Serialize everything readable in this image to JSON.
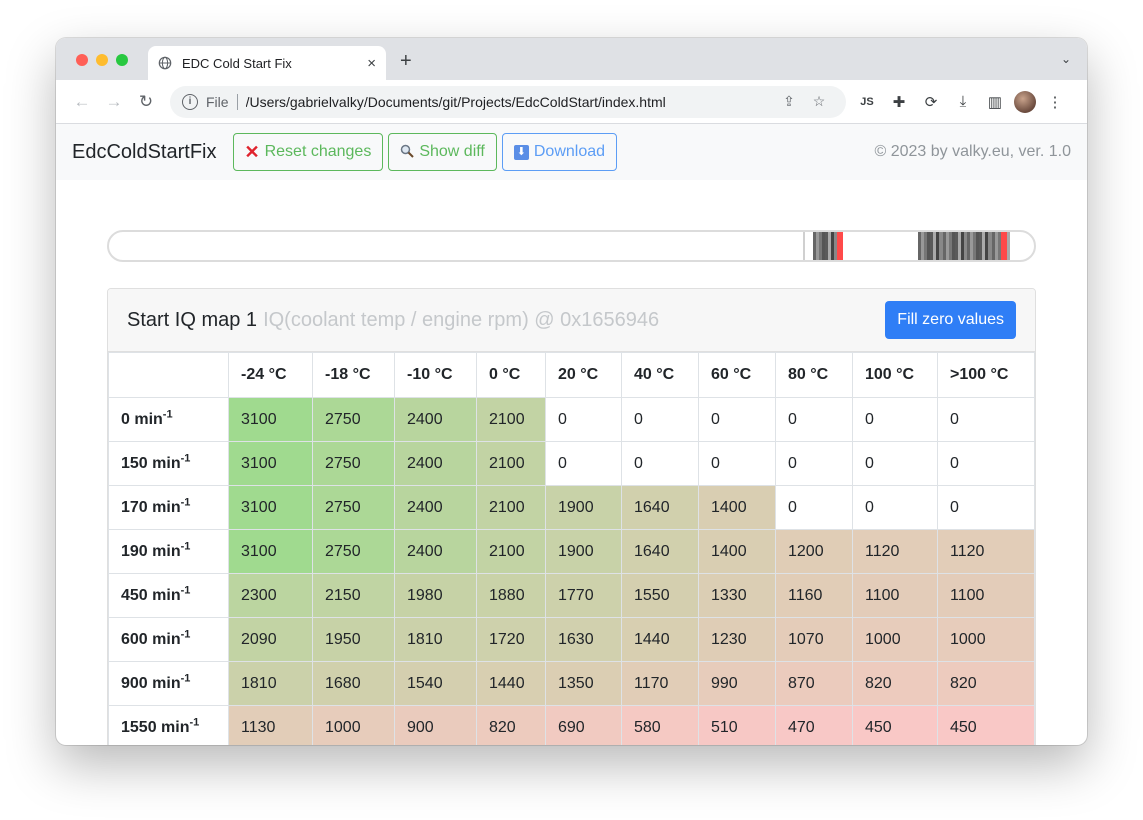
{
  "browser": {
    "tab_title": "EDC Cold Start Fix",
    "tab_close": "×",
    "new_tab": "+",
    "address_scheme": "File",
    "address_url": "/Users/gabrielvalky/Documents/git/Projects/EdcColdStart/index.html"
  },
  "app": {
    "brand": "EdcColdStartFix",
    "reset_label": "Reset changes",
    "diff_label": "Show diff",
    "download_label": "Download",
    "copyright": "© 2023 by valky.eu, ver. 1.0"
  },
  "map": {
    "title": "Start IQ map 1",
    "subtitle": "IQ(coolant temp / engine rpm) @ 0x1656946",
    "fill_button": "Fill zero values",
    "columns": [
      "-24 °C",
      "-18 °C",
      "-10 °C",
      "0 °C",
      "20 °C",
      "40 °C",
      "60 °C",
      "80 °C",
      "100 °C",
      ">100 °C"
    ],
    "rows": [
      {
        "rpm": "0 min",
        "exp": "-1",
        "values": [
          3100,
          2750,
          2400,
          2100,
          0,
          0,
          0,
          0,
          0,
          0
        ]
      },
      {
        "rpm": "150 min",
        "exp": "-1",
        "values": [
          3100,
          2750,
          2400,
          2100,
          0,
          0,
          0,
          0,
          0,
          0
        ]
      },
      {
        "rpm": "170 min",
        "exp": "-1",
        "values": [
          3100,
          2750,
          2400,
          2100,
          1900,
          1640,
          1400,
          0,
          0,
          0
        ]
      },
      {
        "rpm": "190 min",
        "exp": "-1",
        "values": [
          3100,
          2750,
          2400,
          2100,
          1900,
          1640,
          1400,
          1200,
          1120,
          1120
        ]
      },
      {
        "rpm": "450 min",
        "exp": "-1",
        "values": [
          2300,
          2150,
          1980,
          1880,
          1770,
          1550,
          1330,
          1160,
          1100,
          1100
        ]
      },
      {
        "rpm": "600 min",
        "exp": "-1",
        "values": [
          2090,
          1950,
          1810,
          1720,
          1630,
          1440,
          1230,
          1070,
          1000,
          1000
        ]
      },
      {
        "rpm": "900 min",
        "exp": "-1",
        "values": [
          1810,
          1680,
          1540,
          1440,
          1350,
          1170,
          990,
          870,
          820,
          820
        ]
      },
      {
        "rpm": "1550 min",
        "exp": "-1",
        "values": [
          1130,
          1000,
          900,
          820,
          690,
          580,
          510,
          470,
          450,
          450
        ]
      }
    ]
  },
  "colors": {
    "cell_high": "#a0da8f",
    "cell_low": "#f9c8c6",
    "accent": "#2f7ef6"
  },
  "binary_view": {
    "marker_color": "#ff4a4a",
    "byte_shades": [
      "#555555",
      "#777777",
      "#999999",
      "#666666",
      "#888888",
      "#444444",
      "#aaaaaa",
      "#5a5a5a"
    ]
  }
}
